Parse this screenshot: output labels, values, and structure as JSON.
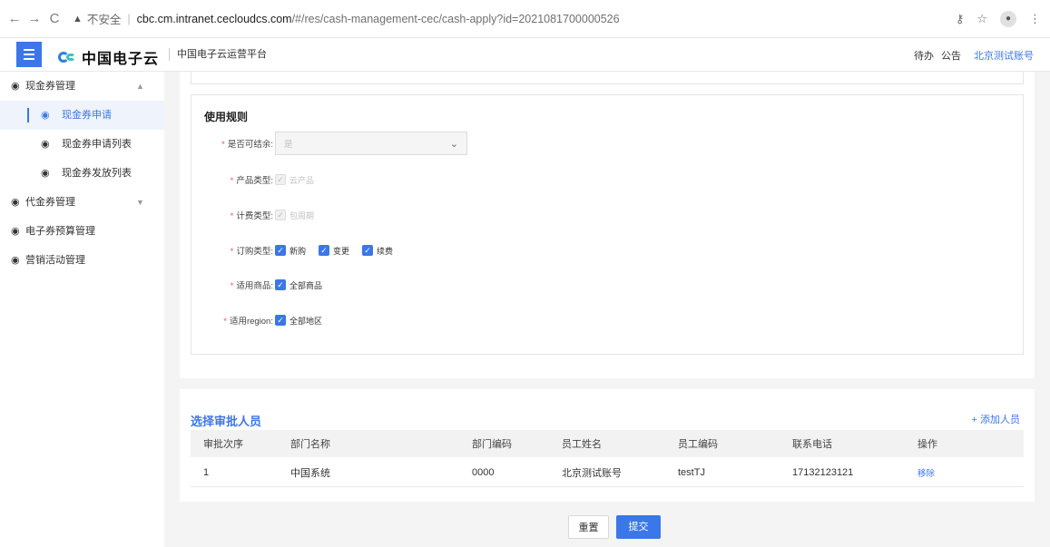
{
  "browser": {
    "back": "←",
    "forward": "→",
    "reload": "C",
    "insecure_label": "不安全",
    "url_host": "cbc.cm.intranet.cecloudcs.com",
    "url_path": "/#/res/cash-management-cec/cash-apply?id=2021081700000526"
  },
  "header": {
    "brand": "中国电子云",
    "platform": "中国电子云运营平台",
    "todo": "待办",
    "notice": "公告",
    "account": "北京测试账号"
  },
  "sidebar": {
    "items": [
      {
        "label": "现金券管理",
        "icon": "dashboard-icon",
        "arrow": "▲"
      },
      {
        "label": "现金券申请",
        "icon": "dashboard-icon",
        "active": true
      },
      {
        "label": "现金券申请列表",
        "icon": "dashboard-icon"
      },
      {
        "label": "现金券发放列表",
        "icon": "dashboard-icon"
      },
      {
        "label": "代金券管理",
        "icon": "dashboard-icon",
        "arrow": "▼"
      },
      {
        "label": "电子券预算管理",
        "icon": "dashboard-icon"
      },
      {
        "label": "营销活动管理",
        "icon": "dashboard-icon"
      }
    ]
  },
  "rules": {
    "title": "使用规则",
    "settle_label": "是否可结余:",
    "settle_value": "是",
    "product_type_label": "产品类型:",
    "product_type_option": "云产品",
    "billing_type_label": "计费类型:",
    "billing_type_option": "包周期",
    "order_type_label": "订购类型:",
    "order_types": [
      "新购",
      "变更",
      "续费"
    ],
    "goods_label": "适用商品:",
    "goods_option": "全部商品",
    "region_label": "适用region:",
    "region_option": "全部地区"
  },
  "approvers": {
    "title": "选择审批人员",
    "add_label": "+ 添加人员",
    "columns": [
      "审批次序",
      "部门名称",
      "部门编码",
      "员工姓名",
      "员工编码",
      "联系电话",
      "操作"
    ],
    "rows": [
      [
        "1",
        "中国系统",
        "0000",
        "北京测试账号",
        "testTJ",
        "17132123121",
        "移除"
      ]
    ]
  },
  "actions": {
    "reset": "重置",
    "submit": "提交"
  },
  "colors": {
    "accent": "#3b77e8"
  }
}
